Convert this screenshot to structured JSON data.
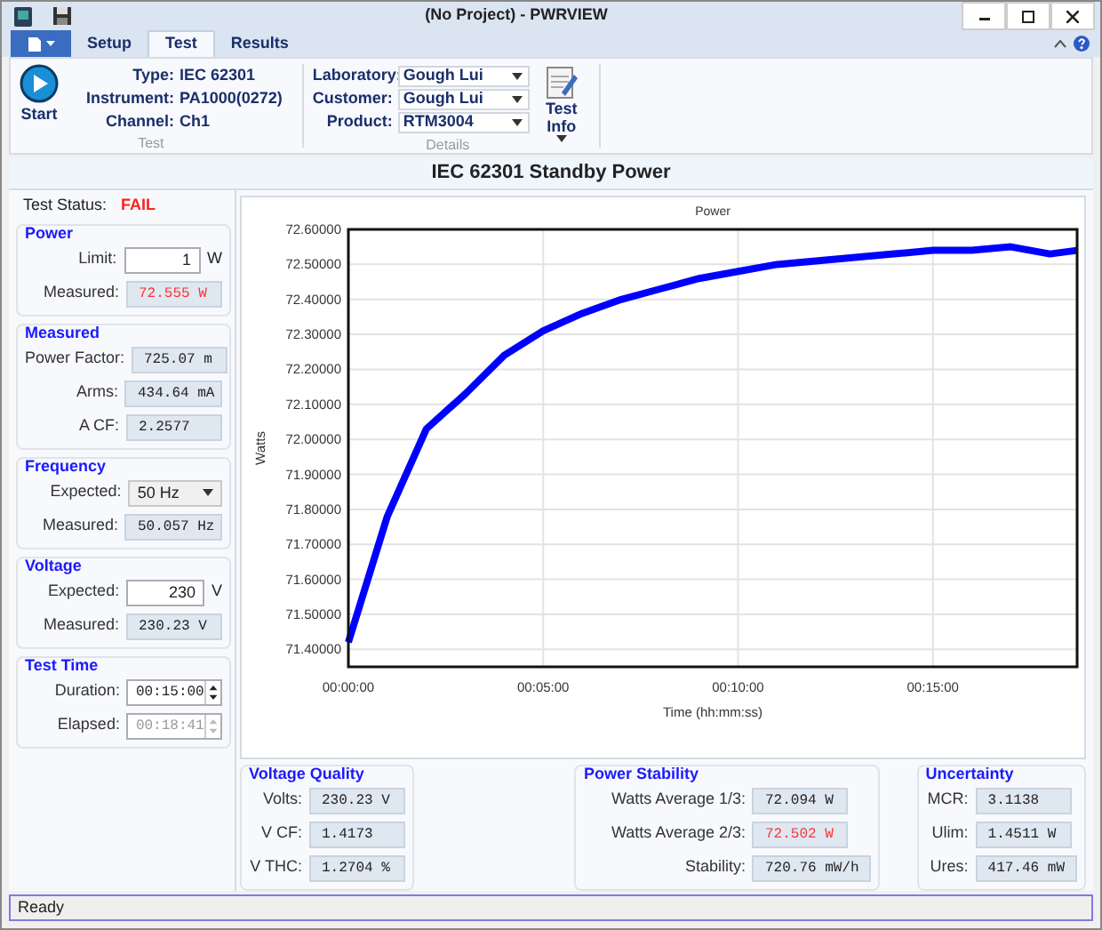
{
  "window": {
    "title": "(No Project) - PWRVIEW"
  },
  "ribbon": {
    "tabs": [
      {
        "label": "Setup",
        "selected": false
      },
      {
        "label": "Test",
        "selected": true
      },
      {
        "label": "Results",
        "selected": false
      }
    ],
    "test_group": {
      "start_button": "Start",
      "fields": [
        {
          "label": "Type:",
          "value": "IEC 62301"
        },
        {
          "label": "Instrument:",
          "value": "PA1000(0272)"
        },
        {
          "label": "Channel:",
          "value": "Ch1"
        }
      ],
      "caption": "Test"
    },
    "details_group": {
      "fields": [
        {
          "label": "Laboratory:",
          "value": "Gough Lui"
        },
        {
          "label": "Customer:",
          "value": "Gough Lui"
        },
        {
          "label": "Product:",
          "value": "RTM3004"
        }
      ],
      "test_info_button": "Test Info",
      "caption": "Details"
    }
  },
  "header": "IEC 62301 Standby Power",
  "test_status": {
    "label": "Test Status:",
    "value": "FAIL"
  },
  "left_groups": [
    {
      "title": "Power",
      "rows": [
        {
          "kind": "input",
          "label": "Limit:",
          "value": "1",
          "unit": "W"
        },
        {
          "kind": "readout",
          "label": "Measured:",
          "value": "72.555 W",
          "alert": true
        }
      ]
    },
    {
      "title": "Measured",
      "rows": [
        {
          "kind": "readout",
          "label": "Power Factor:",
          "value": "725.07 m",
          "alert": false
        },
        {
          "kind": "readout",
          "label": "Arms:",
          "value": "434.64 mA",
          "alert": false
        },
        {
          "kind": "readout",
          "label": "A CF:",
          "value": "2.2577",
          "alert": false
        }
      ]
    },
    {
      "title": "Frequency",
      "rows": [
        {
          "kind": "select",
          "label": "Expected:",
          "value": "50 Hz"
        },
        {
          "kind": "readout",
          "label": "Measured:",
          "value": "50.057 Hz",
          "alert": false
        }
      ]
    },
    {
      "title": "Voltage",
      "rows": [
        {
          "kind": "input",
          "label": "Expected:",
          "value": "230",
          "unit": "V"
        },
        {
          "kind": "readout",
          "label": "Measured:",
          "value": "230.23 V",
          "alert": false
        }
      ]
    },
    {
      "title": "Test Time",
      "rows": [
        {
          "kind": "spin",
          "label": "Duration:",
          "value": "00:15:00",
          "disabled": false
        },
        {
          "kind": "spin",
          "label": "Elapsed:",
          "value": "00:18:41",
          "disabled": true
        }
      ]
    }
  ],
  "chart": {
    "chart_data": {
      "type": "line",
      "title": "Power",
      "xlabel": "Time (hh:mm:ss)",
      "ylabel": "Watts",
      "x": [
        0,
        1,
        2,
        3,
        4,
        5,
        6,
        7,
        8,
        9,
        10,
        11,
        12,
        13,
        14,
        15,
        16,
        17,
        18,
        18.7
      ],
      "grid": true,
      "series": [
        {
          "color": "#0000ff",
          "values": [
            71.42,
            71.78,
            72.03,
            72.13,
            72.24,
            72.31,
            72.36,
            72.4,
            72.43,
            72.46,
            72.48,
            72.5,
            72.51,
            72.52,
            72.53,
            72.54,
            72.54,
            72.55,
            72.53,
            72.54
          ]
        }
      ],
      "xlim": [
        0,
        18.7
      ],
      "ylim": [
        71.35,
        72.6
      ],
      "xticks": [
        {
          "value": 0,
          "label": "00:00:00"
        },
        {
          "value": 5,
          "label": "00:05:00"
        },
        {
          "value": 10,
          "label": "00:10:00"
        },
        {
          "value": 15,
          "label": "00:15:00"
        }
      ],
      "yticks": [
        {
          "value": 71.4,
          "label": "71.40000"
        },
        {
          "value": 71.5,
          "label": "71.50000"
        },
        {
          "value": 71.6,
          "label": "71.60000"
        },
        {
          "value": 71.7,
          "label": "71.70000"
        },
        {
          "value": 71.8,
          "label": "71.80000"
        },
        {
          "value": 71.9,
          "label": "71.90000"
        },
        {
          "value": 72.0,
          "label": "72.00000"
        },
        {
          "value": 72.1,
          "label": "72.10000"
        },
        {
          "value": 72.2,
          "label": "72.20000"
        },
        {
          "value": 72.3,
          "label": "72.30000"
        },
        {
          "value": 72.4,
          "label": "72.40000"
        },
        {
          "value": 72.5,
          "label": "72.50000"
        },
        {
          "value": 72.6,
          "label": "72.60000"
        }
      ]
    }
  },
  "bottom_groups": [
    {
      "title": "Voltage Quality",
      "rows": [
        {
          "kind": "readout",
          "label": "Volts:",
          "value": "230.23 V",
          "alert": false
        },
        {
          "kind": "readout",
          "label": "V CF:",
          "value": "1.4173",
          "alert": false
        },
        {
          "kind": "readout",
          "label": "V THC:",
          "value": "1.2704 %",
          "alert": false
        }
      ]
    },
    {
      "title": "Power Stability",
      "rows": [
        {
          "kind": "readout",
          "label": "Watts Average 1/3:",
          "value": "72.094 W",
          "alert": false
        },
        {
          "kind": "readout",
          "label": "Watts Average 2/3:",
          "value": "72.502 W",
          "alert": true
        },
        {
          "kind": "readout",
          "label": "Stability:",
          "value": "720.76 mW/h",
          "alert": false
        }
      ]
    },
    {
      "title": "Uncertainty",
      "rows": [
        {
          "kind": "readout",
          "label": "MCR:",
          "value": "3.1138",
          "alert": false
        },
        {
          "kind": "readout",
          "label": "Ulim:",
          "value": "1.4511 W",
          "alert": false
        },
        {
          "kind": "readout",
          "label": "Ures:",
          "value": "417.46 mW",
          "alert": false
        }
      ]
    }
  ],
  "status_bar": "Ready"
}
